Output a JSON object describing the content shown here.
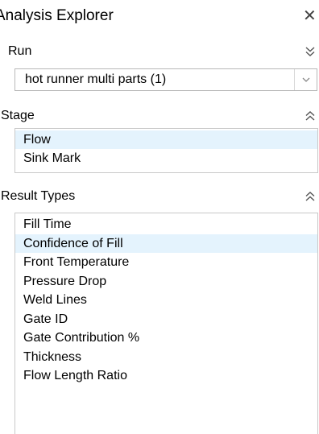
{
  "panel": {
    "title": "Analysis Explorer",
    "close_icon": "close-icon"
  },
  "run": {
    "label": "Run",
    "toggle_icon": "double-chevron-down-icon",
    "selected_value": "hot runner multi parts (1)",
    "dropdown_icon": "chevron-down-icon"
  },
  "stage": {
    "label": "Stage",
    "toggle_icon": "double-chevron-up-icon",
    "items": [
      {
        "label": "Flow",
        "selected": true
      },
      {
        "label": "Sink Mark",
        "selected": false
      }
    ]
  },
  "result_types": {
    "label": "Result Types",
    "toggle_icon": "double-chevron-up-icon",
    "items": [
      {
        "label": "Fill Time",
        "selected": false
      },
      {
        "label": "Confidence of Fill",
        "selected": true
      },
      {
        "label": "Front Temperature",
        "selected": false
      },
      {
        "label": "Pressure Drop",
        "selected": false
      },
      {
        "label": "Weld Lines",
        "selected": false
      },
      {
        "label": "Gate ID",
        "selected": false
      },
      {
        "label": "Gate Contribution %",
        "selected": false
      },
      {
        "label": "Thickness",
        "selected": false
      },
      {
        "label": "Flow Length Ratio",
        "selected": false
      }
    ]
  },
  "colors": {
    "selection_bg": "#e4f3fd",
    "border": "#c8c8c8",
    "text": "#000000"
  }
}
